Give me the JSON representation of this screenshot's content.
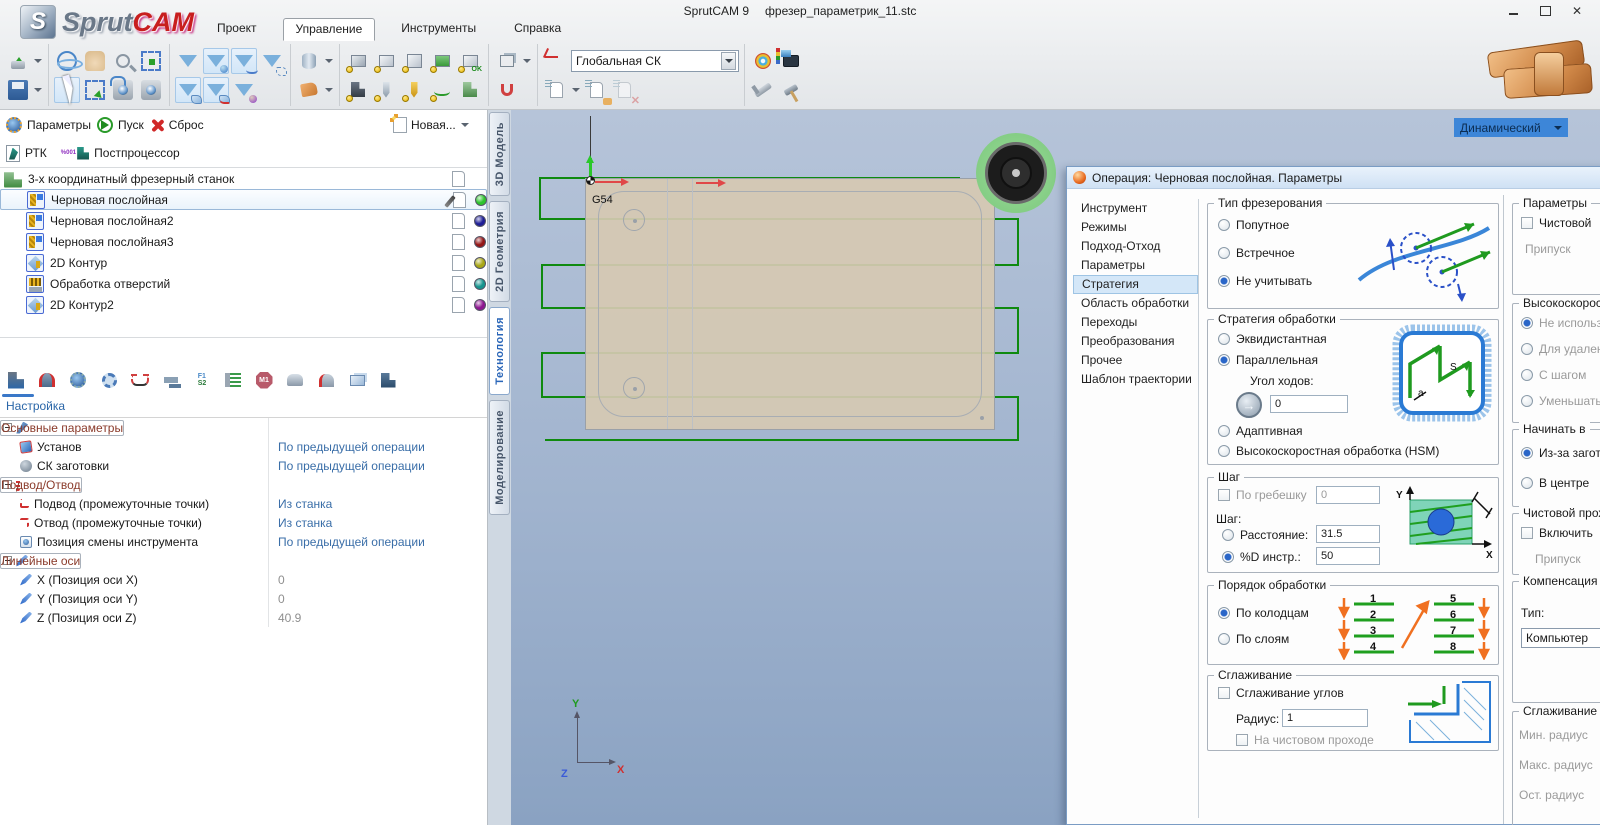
{
  "titlebar": {
    "app_title": "SprutCAM 9",
    "doc_title": "фрезер_параметрик_11.stc",
    "logo_emblem": "S",
    "logo_part1": "Sprut",
    "logo_part2": "CAM"
  },
  "menu": {
    "items": [
      {
        "label": "Проект",
        "active": false
      },
      {
        "label": "Управление",
        "active": true
      },
      {
        "label": "Инструменты",
        "active": false
      },
      {
        "label": "Справка",
        "active": false
      }
    ]
  },
  "toolbar": {
    "cs_combo_value": "Глобальная СК",
    "ok_badge": "OK"
  },
  "runbar": {
    "parameters_label": "Параметры",
    "start_label": "Пуск",
    "reset_label": "Сброс",
    "new_label": "Новая...",
    "rtk_label": "РТК",
    "postprocessor_label": "Постпроцессор",
    "pp_icon_text": "%001"
  },
  "tree": {
    "machine_label": "3-х координатный фрезерный станок",
    "operations": [
      {
        "label": "Черновая послойная",
        "dot": "#2dc42d",
        "selected": true,
        "kind": "rough"
      },
      {
        "label": "Черновая послойная2",
        "dot": "#1e1e96",
        "selected": false,
        "kind": "rough"
      },
      {
        "label": "Черновая послойная3",
        "dot": "#941616",
        "selected": false,
        "kind": "rough"
      },
      {
        "label": "2D Контур",
        "dot": "#a8a616",
        "selected": false,
        "kind": "contour"
      },
      {
        "label": "Обработка отверстий",
        "dot": "#16948e",
        "selected": false,
        "kind": "holes"
      },
      {
        "label": "2D Контур2",
        "dot": "#8e1690",
        "selected": false,
        "kind": "contour"
      }
    ]
  },
  "settings": {
    "tab_label": "Настройка",
    "feeds_icon_top": "F1",
    "feeds_icon_bottom": "S2",
    "m1_icon_text": "M1"
  },
  "params_table": {
    "rows": [
      {
        "is_group": true,
        "icon": "wrench",
        "label": "Основные параметры",
        "value": "",
        "value_kind": ""
      },
      {
        "is_group": false,
        "icon": "setup",
        "label": "Установ",
        "value": "По предыдущей операции",
        "value_kind": "link"
      },
      {
        "is_group": false,
        "icon": "cs",
        "label": "СК заготовки",
        "value": "По предыдущей операции",
        "value_kind": "link"
      },
      {
        "is_group": true,
        "icon": "inout",
        "label": "Подвод/Отвод",
        "value": "",
        "value_kind": ""
      },
      {
        "is_group": false,
        "icon": "in",
        "label": "Подвод (промежуточные точки)",
        "value": "Из станка",
        "value_kind": "link"
      },
      {
        "is_group": false,
        "icon": "out",
        "label": "Отвод (промежуточные точки)",
        "value": "Из станка",
        "value_kind": "link"
      },
      {
        "is_group": false,
        "icon": "toolchange",
        "label": "Позиция смены инструмента",
        "value": "По предыдущей операции",
        "value_kind": "link"
      },
      {
        "is_group": true,
        "icon": "axes",
        "label": "Линейные оси",
        "value": "",
        "value_kind": ""
      },
      {
        "is_group": false,
        "icon": "axis",
        "label": "X (Позиция оси X)",
        "value": "0",
        "value_kind": "num"
      },
      {
        "is_group": false,
        "icon": "axis",
        "label": "Y (Позиция оси Y)",
        "value": "0",
        "value_kind": "num"
      },
      {
        "is_group": false,
        "icon": "axis",
        "label": "Z (Позиция оси Z)",
        "value": "40.9",
        "value_kind": "num"
      }
    ]
  },
  "side_tabs": [
    {
      "label": "3D Модель",
      "active": false
    },
    {
      "label": "2D Геометрия",
      "active": false
    },
    {
      "label": "Технология",
      "active": true
    },
    {
      "label": "Моделирование",
      "active": false
    }
  ],
  "viewport": {
    "wcs_label": "G54",
    "view_mode": "Динамический",
    "axis_x": "X",
    "axis_y": "Y",
    "axis_z": "Z"
  },
  "dialog": {
    "title": "Операция: Черновая послойная. Параметры",
    "nav": [
      {
        "label": "Инструмент",
        "active": false
      },
      {
        "label": "Режимы",
        "active": false
      },
      {
        "label": "Подход-Отход",
        "active": false
      },
      {
        "label": "Параметры",
        "active": false
      },
      {
        "label": "Стратегия",
        "active": true
      },
      {
        "label": "Область обработки",
        "active": false
      },
      {
        "label": "Переходы",
        "active": false
      },
      {
        "label": "Преобразования",
        "active": false
      },
      {
        "label": "Прочее",
        "active": false
      },
      {
        "label": "Шаблон траектории",
        "active": false
      }
    ],
    "mill_type": {
      "title": "Тип фрезерования",
      "options": [
        {
          "label": "Попутное",
          "checked": false
        },
        {
          "label": "Встречное",
          "checked": false
        },
        {
          "label": "Не учитывать",
          "checked": true
        }
      ]
    },
    "strategy": {
      "title": "Стратегия обработки",
      "opt_equidistant": {
        "label": "Эквидистантная",
        "checked": false
      },
      "opt_parallel": {
        "label": "Параллельная",
        "checked": true
      },
      "angle_label": "Угол ходов:",
      "angle_value": "0",
      "opt_adaptive": {
        "label": "Адаптивная",
        "checked": false
      },
      "opt_hsm": {
        "label": "Высокоскоростная обработка (HSM)",
        "checked": false
      },
      "fig_s": "S",
      "fig_a": "a"
    },
    "step": {
      "title": "Шаг",
      "scallop_label": "По гребешку",
      "scallop_value": "0",
      "step_label": "Шаг:",
      "distance_label": "Расстояние:",
      "distance_value": "31.5",
      "percent_label": "%D инстр.:",
      "percent_value": "50",
      "fig_x": "X",
      "fig_y": "Y"
    },
    "order": {
      "title": "Порядок обработки",
      "opt_pockets": {
        "label": "По колодцам",
        "checked": true
      },
      "opt_layers": {
        "label": "По слоям",
        "checked": false
      },
      "numbers_left": [
        "1",
        "2",
        "3",
        "4"
      ],
      "numbers_right": [
        "5",
        "6",
        "7",
        "8"
      ]
    },
    "smoothing": {
      "title": "Сглаживание",
      "corners_label": "Сглаживание углов",
      "radius_label": "Радиус:",
      "radius_value": "1",
      "finish_label": "На чистовом проходе"
    },
    "right_panel": {
      "params": {
        "title": "Параметры",
        "check_label": "Чистовой",
        "sub_label": "Припуск"
      },
      "hsm": {
        "title": "Высокоскоростная",
        "options": [
          {
            "label": "Не использовать",
            "checked": true,
            "disabled": true
          },
          {
            "label": "Для удаления",
            "checked": false,
            "disabled": true
          },
          {
            "label": "С шагом",
            "checked": false,
            "disabled": true
          },
          {
            "label": "Уменьшать",
            "checked": false,
            "disabled": true
          }
        ]
      },
      "start_in": {
        "title": "Начинать в",
        "options": [
          {
            "label": "Из-за заготовки",
            "checked": true,
            "disabled": false
          },
          {
            "label": "В центре",
            "checked": false,
            "disabled": false
          }
        ]
      },
      "finish_pass": {
        "title": "Чистовой проход",
        "check_label": "Включить",
        "sub_label": "Припуск"
      },
      "compensation": {
        "title": "Компенсация",
        "type_label": "Тип:",
        "combo_value": "Компьютер"
      },
      "smoothing2": {
        "title": "Сглаживание",
        "labels": [
          "Мин. радиус",
          "Макс. радиус",
          "Ост. радиус"
        ]
      }
    }
  }
}
